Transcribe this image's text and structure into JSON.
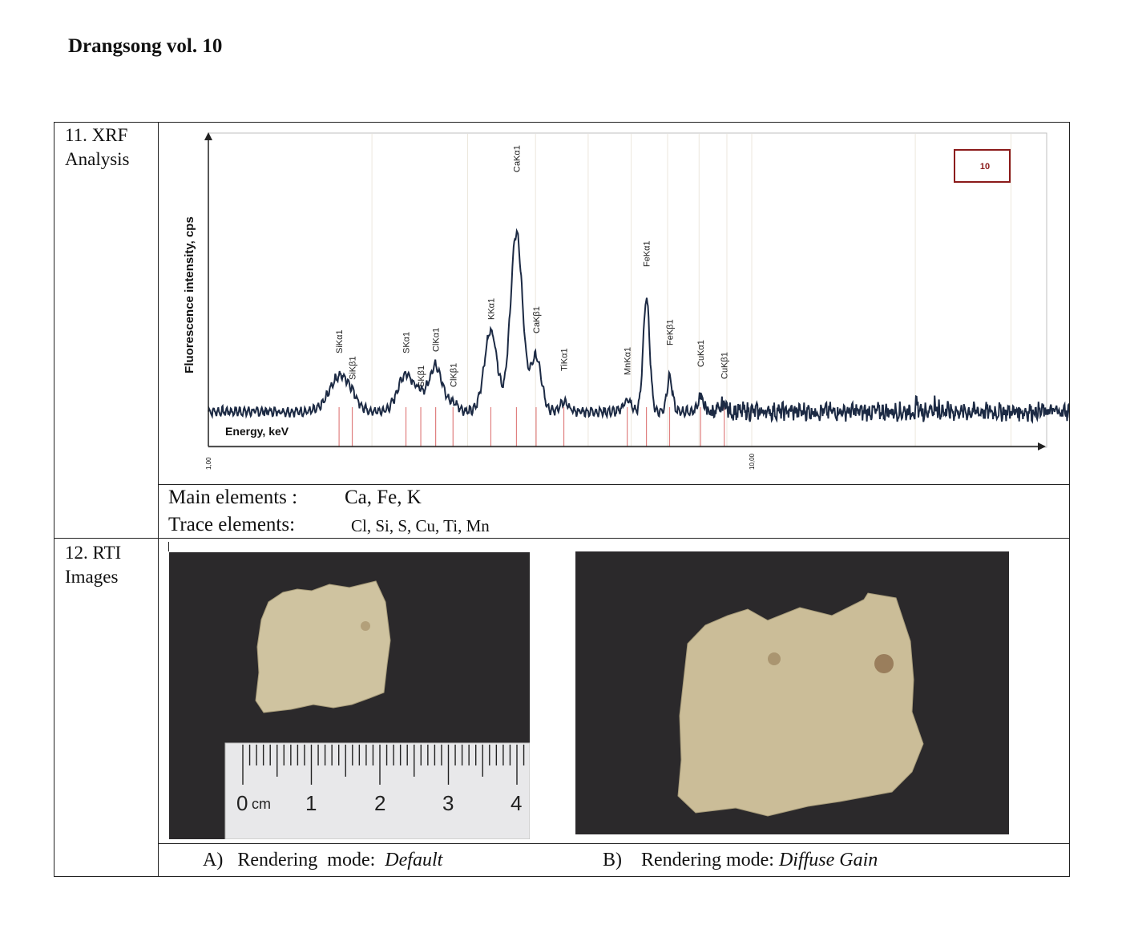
{
  "header": {
    "title": "Drangsong vol. 10"
  },
  "sections": {
    "xrf": {
      "label_line1": "11. XRF",
      "label_line2": "Analysis"
    },
    "rti": {
      "label_line1": "12. RTI",
      "label_line2": "Images"
    }
  },
  "chart_data": {
    "type": "line",
    "title": "",
    "xlabel": "Energy, keV",
    "ylabel": "Fluorescence intensity, cps",
    "x_scale": "log",
    "xlim": [
      1.0,
      40.0
    ],
    "ylim": [
      0,
      100
    ],
    "x_tick_labels": [
      "1,00",
      "10,00"
    ],
    "legend_box_text": "10",
    "grid": true,
    "series": [
      {
        "x": [
          1.0,
          1.25,
          1.5,
          1.7,
          1.74,
          1.8,
          1.9,
          2.0,
          2.15,
          2.31,
          2.45,
          2.56,
          2.62,
          2.7,
          2.9,
          3.13,
          3.35,
          3.5,
          3.69,
          3.9,
          4.01,
          4.2,
          4.51,
          4.8,
          4.93,
          5.2,
          5.9,
          6.1,
          6.4,
          6.6,
          7.06,
          7.5,
          8.05,
          8.5,
          8.9,
          10.0,
          15.0,
          20.0,
          25.0,
          30.0,
          40.0
        ],
        "y": [
          11,
          12,
          14,
          22,
          24,
          14,
          14,
          12,
          11,
          24,
          12,
          20,
          28,
          13,
          13,
          14,
          31,
          12,
          72,
          13,
          37,
          13,
          14,
          12,
          13,
          11,
          13,
          51,
          14,
          19,
          11,
          14,
          12,
          13,
          10,
          12,
          12,
          13,
          14,
          12,
          11
        ]
      }
    ],
    "peaks": [
      {
        "label": "SiKα1",
        "energy": 1.74
      },
      {
        "label": "SiKβ1",
        "energy": 1.84
      },
      {
        "label": "SKα1",
        "energy": 2.31
      },
      {
        "label": "SKβ1",
        "energy": 2.46
      },
      {
        "label": "ClKα1",
        "energy": 2.62
      },
      {
        "label": "ClKβ1",
        "energy": 2.82
      },
      {
        "label": "KKα1",
        "energy": 3.31
      },
      {
        "label": "CaKα1",
        "energy": 3.69
      },
      {
        "label": "CaKβ1",
        "energy": 4.01
      },
      {
        "label": "TiKα1",
        "energy": 4.51
      },
      {
        "label": "MnKα1",
        "energy": 5.9
      },
      {
        "label": "FeKα1",
        "energy": 6.4
      },
      {
        "label": "FeKβ1",
        "energy": 7.06
      },
      {
        "label": "CuKα1",
        "energy": 8.05
      },
      {
        "label": "CuKβ1",
        "energy": 8.9
      }
    ]
  },
  "elements": {
    "main_label": "Main elements :",
    "main_value": "Ca, Fe, K",
    "trace_label": "Trace elements:",
    "trace_value": "Cl, Si, S, Cu, Ti, Mn"
  },
  "ruler": {
    "labels": [
      "0",
      "1",
      "2",
      "3",
      "4"
    ],
    "unit": "cm"
  },
  "captions": {
    "a_prefix": "A)",
    "a_text": "Rendering  mode:",
    "a_mode": "Default",
    "b_prefix": "B)",
    "b_text": "Rendering mode:",
    "b_mode": "Diffuse Gain"
  },
  "colors": {
    "spectrum": "#1c2a44",
    "peak_marker": "#e08080",
    "legend_border": "#8b1a1a",
    "photo_bg": "#2b292b",
    "paper": "#cfc3a0"
  }
}
